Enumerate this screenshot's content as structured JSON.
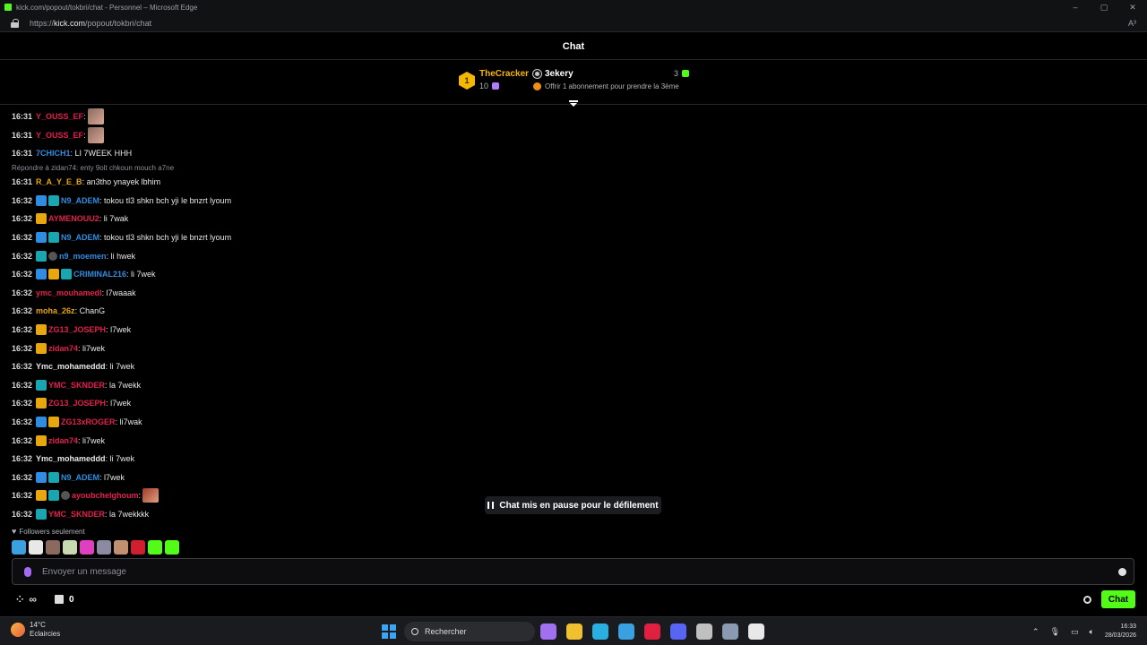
{
  "browser": {
    "title": "kick.com/popout/tokbri/chat - Personnel – Microsoft Edge",
    "url_prefix": "https://",
    "url_host": "kick.com",
    "url_path": "/popout/tokbri/chat",
    "read_aloud": "A³"
  },
  "header": {
    "title": "Chat"
  },
  "leaderboard": {
    "rank": "1",
    "top_user": "TheCracker",
    "top_count": "10",
    "second_user": "3ekery",
    "second_count": "3",
    "offer": "Offrir 1 abonnement pour prendre la 3ème"
  },
  "messages": [
    {
      "time": "16:31",
      "badges": [],
      "user": "Y_OUSS_EF",
      "color": "#e3204b",
      "text": ":",
      "emote": true
    },
    {
      "time": "16:31",
      "badges": [],
      "user": "Y_OUSS_EF",
      "color": "#e3204b",
      "text": ":",
      "emote": true
    },
    {
      "time": "16:31",
      "badges": [],
      "user": "7CHICH1",
      "color": "#2f8ce0",
      "text": ": LI 7WEEK HHH"
    },
    {
      "time": "16:31",
      "badges": [],
      "user": "R_A_Y_E_B",
      "color": "#e8a70e",
      "text": ": an3tho ynayek lbhim",
      "reply": "Répondre à zidan74: enty 9olt chkoun mouch a7ne"
    },
    {
      "time": "16:32",
      "badges": [
        "arrow",
        "sub"
      ],
      "user": "N9_ADEM",
      "color": "#2f8ce0",
      "text": ": tokou tl3 shkn bch yji le bnzrt lyoum"
    },
    {
      "time": "16:32",
      "badges": [
        "crown"
      ],
      "user": "AYMENOUU2",
      "color": "#e3204b",
      "text": ": li 7wak"
    },
    {
      "time": "16:32",
      "badges": [
        "arrow",
        "sub"
      ],
      "user": "N9_ADEM",
      "color": "#2f8ce0",
      "text": ": tokou tl3 shkn bch yji le bnzrt lyoum"
    },
    {
      "time": "16:32",
      "badges": [
        "sub",
        "pfp"
      ],
      "user": "n9_moemen",
      "color": "#2f8ce0",
      "text": ": li hwek"
    },
    {
      "time": "16:32",
      "badges": [
        "arrow",
        "crown",
        "sub"
      ],
      "user": "CRIMINAL216",
      "color": "#2f8ce0",
      "text": ": li 7wek"
    },
    {
      "time": "16:32",
      "badges": [],
      "user": "ymc_mouhamedl",
      "color": "#e3204b",
      "text": ": l7waaak"
    },
    {
      "time": "16:32",
      "badges": [],
      "user": "moha_26z",
      "color": "#e8a70e",
      "text": ": ChanG"
    },
    {
      "time": "16:32",
      "badges": [
        "crown"
      ],
      "user": "ZG13_JOSEPH",
      "color": "#e3204b",
      "text": ": l7wek"
    },
    {
      "time": "16:32",
      "badges": [
        "crown"
      ],
      "user": "zidan74",
      "color": "#e3204b",
      "text": ": li7wek"
    },
    {
      "time": "16:32",
      "badges": [],
      "user": "Ymc_mohameddd",
      "color": "#e8e8e8",
      "text": ": li 7wek"
    },
    {
      "time": "16:32",
      "badges": [
        "sub"
      ],
      "user": "YMC_SKNDER",
      "color": "#e3204b",
      "text": ": la 7wekk"
    },
    {
      "time": "16:32",
      "badges": [
        "crown"
      ],
      "user": "ZG13_JOSEPH",
      "color": "#e3204b",
      "text": ": l7wek"
    },
    {
      "time": "16:32",
      "badges": [
        "arrow",
        "crown"
      ],
      "user": "ZG13xROGER",
      "color": "#e3204b",
      "text": ": li7wak"
    },
    {
      "time": "16:32",
      "badges": [
        "crown"
      ],
      "user": "zidan74",
      "color": "#e3204b",
      "text": ": li7wek"
    },
    {
      "time": "16:32",
      "badges": [],
      "user": "Ymc_mohameddd",
      "color": "#e8e8e8",
      "text": ": li 7wek"
    },
    {
      "time": "16:32",
      "badges": [
        "arrow",
        "sub"
      ],
      "user": "N9_ADEM",
      "color": "#2f8ce0",
      "text": ": l7wek"
    },
    {
      "time": "16:32",
      "badges": [
        "crown",
        "sub",
        "pfp"
      ],
      "user": "ayoubchelghoum",
      "color": "#e3204b",
      "text": ":",
      "emote": true
    },
    {
      "time": "16:32",
      "badges": [
        "sub"
      ],
      "user": "YMC_SKNDER",
      "color": "#e3204b",
      "text": ": la 7wekkkk"
    }
  ],
  "pause_notice": "Chat mis en pause pour le défilement",
  "followers_only": "Followers seulement",
  "emote_colors": [
    "#3aa0e0",
    "#e8e8e8",
    "#8a6a5e",
    "#c8d8b0",
    "#e040c0",
    "#8a8aa0",
    "#c09070",
    "#d02030",
    "#53fc18",
    "#53fc18"
  ],
  "input": {
    "placeholder": "Envoyer un message"
  },
  "footer": {
    "points": "0",
    "chat_button": "Chat"
  },
  "taskbar": {
    "temp": "14°C",
    "weather": "Eclaircies",
    "search": "Rechercher",
    "time": "16:33",
    "date": "28/03/2026",
    "app_colors": [
      "#a070f0",
      "#f0c030",
      "#2ab0e0",
      "#3aa0e0",
      "#e02040",
      "#5865f2",
      "#c0c0c0",
      "#8a9ab0",
      "#e8e8e8"
    ]
  }
}
